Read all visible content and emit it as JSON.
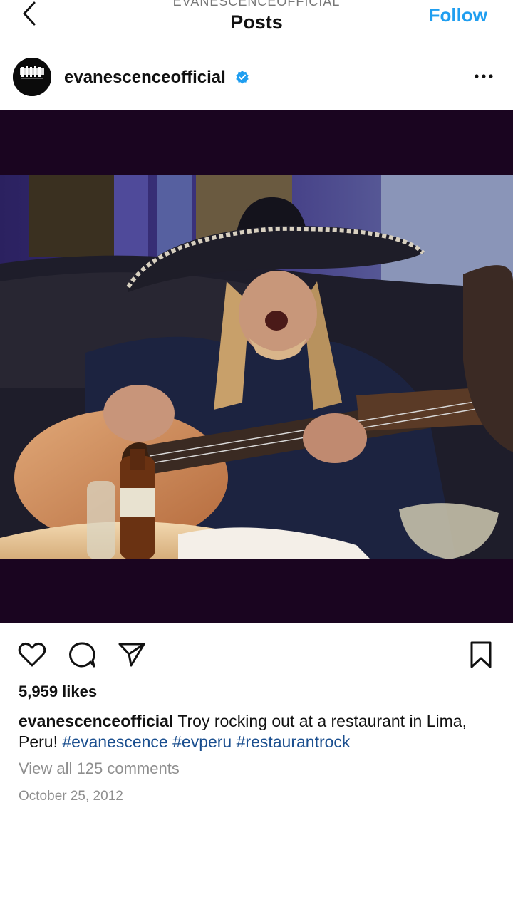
{
  "header": {
    "account_caption": "EVANESCENCEOFFICIAL",
    "title": "Posts",
    "follow_label": "Follow",
    "back_icon": "chevron-left-icon"
  },
  "post": {
    "username": "evanescenceofficial",
    "verified_icon": "verified-badge-icon",
    "more_icon": "more-options-icon",
    "image_alt": "Photo of a long-haired man in a sombrero laughing while playing a 12-string acoustic guitar in a restaurant booth",
    "likes": "5,959 likes",
    "caption_user": "evanescenceofficial",
    "caption_text": " Troy rocking out at a restaurant in Lima, Peru! ",
    "hashtags": [
      "#evanescence",
      "#evperu",
      "#restaurantrock"
    ],
    "comments_link": "View all 125 comments",
    "date": "October 25, 2012"
  },
  "colors": {
    "accent": "#1f9ef0",
    "hashtag": "#1b4f8f",
    "muted": "#8e8e8e"
  }
}
